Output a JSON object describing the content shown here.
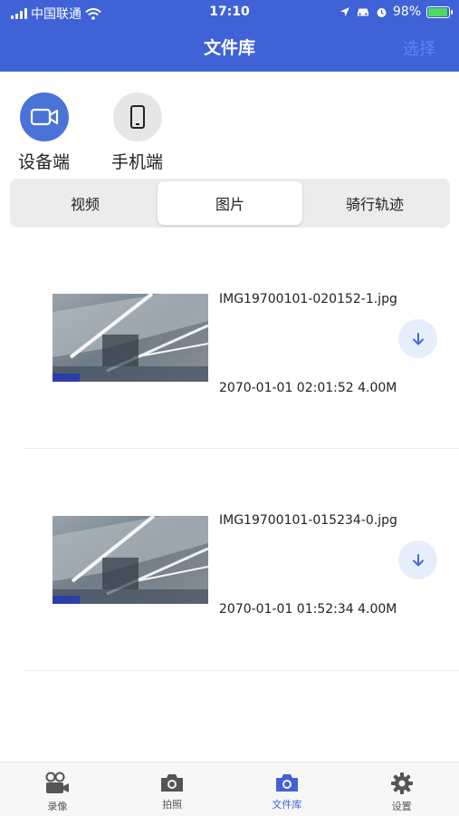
{
  "status_bar": {
    "carrier": "中国联通",
    "time": "17:10",
    "battery": "98%",
    "battery_level": 0.98
  },
  "header": {
    "title": "文件库",
    "select_label": "选择"
  },
  "sources": [
    {
      "label": "设备端",
      "icon": "video-camera-icon",
      "active": true
    },
    {
      "label": "手机端",
      "icon": "phone-icon",
      "active": false
    }
  ],
  "tabs": [
    {
      "label": "视频",
      "active": false
    },
    {
      "label": "图片",
      "active": true
    },
    {
      "label": "骑行轨迹",
      "active": false
    }
  ],
  "files": [
    {
      "name": "IMG19700101-020152-1.jpg",
      "meta": "2070-01-01 02:01:52  4.00M"
    },
    {
      "name": "IMG19700101-015234-0.jpg",
      "meta": "2070-01-01 01:52:34  4.00M"
    }
  ],
  "bottom_nav": [
    {
      "label": "录像",
      "icon": "video-record-icon",
      "active": false
    },
    {
      "label": "拍照",
      "icon": "camera-icon",
      "active": false
    },
    {
      "label": "文件库",
      "icon": "file-library-icon",
      "active": true
    },
    {
      "label": "设置",
      "icon": "gear-icon",
      "active": false
    }
  ],
  "colors": {
    "header_bg": "#3f62d6",
    "accent": "#4a73d8",
    "download_bg": "#e7eefb"
  }
}
